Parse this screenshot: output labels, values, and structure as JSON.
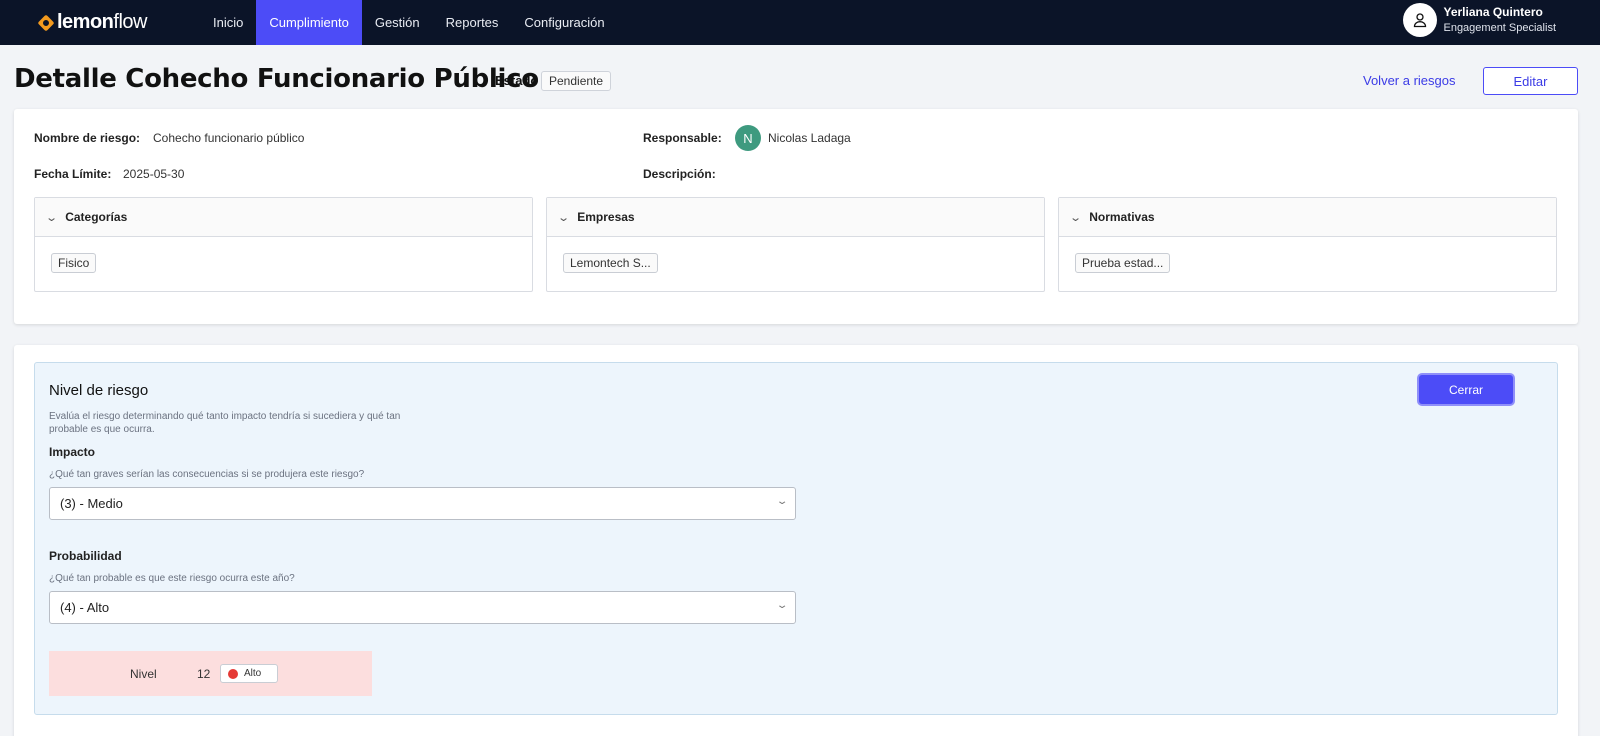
{
  "nav": {
    "logo_prefix": "lemon",
    "logo_suffix": "flow",
    "items": [
      "Inicio",
      "Cumplimiento",
      "Gestión",
      "Reportes",
      "Configuración"
    ],
    "active_index": 1,
    "user_name": "Yerliana Quintero",
    "user_role": "Engagement Specialist"
  },
  "header": {
    "title": "Detalle Cohecho Funcionario Público",
    "estado_label": "Estado",
    "estado_value": "Pendiente",
    "back_link": "Volver a riesgos",
    "edit_label": "Editar"
  },
  "details": {
    "nombre_label": "Nombre de riesgo:",
    "nombre_value": "Cohecho funcionario público",
    "fecha_label": "Fecha Límite:",
    "fecha_value": "2025-05-30",
    "responsable_label": "Responsable:",
    "responsable_initial": "N",
    "responsable_name": "Nicolas Ladaga",
    "descripcion_label": "Descripción:"
  },
  "panels": [
    {
      "title": "Categorías",
      "tag": "Fisico"
    },
    {
      "title": "Empresas",
      "tag": "Lemontech S..."
    },
    {
      "title": "Normativas",
      "tag": "Prueba estad..."
    }
  ],
  "risk": {
    "title": "Nivel de riesgo",
    "description": "Evalúa el riesgo determinando qué tanto impacto tendría si sucediera y qué tan probable es que ocurra.",
    "close_label": "Cerrar",
    "impacto_label": "Impacto",
    "impacto_question": "¿Qué tan graves serían las consecuencias si se produjera este riesgo?",
    "impacto_value": "(3) - Medio",
    "prob_label": "Probabilidad",
    "prob_question": "¿Qué tan probable es que este riesgo ocurra este año?",
    "prob_value": "(4) - Alto",
    "nivel_label": "Nivel",
    "nivel_value": "12",
    "nivel_badge": "Alto",
    "nivel_color": "#e53935"
  },
  "colors": {
    "accent": "#4c4cf7",
    "nav_bg": "#0b1428",
    "nivel_bg": "#fcdede"
  }
}
